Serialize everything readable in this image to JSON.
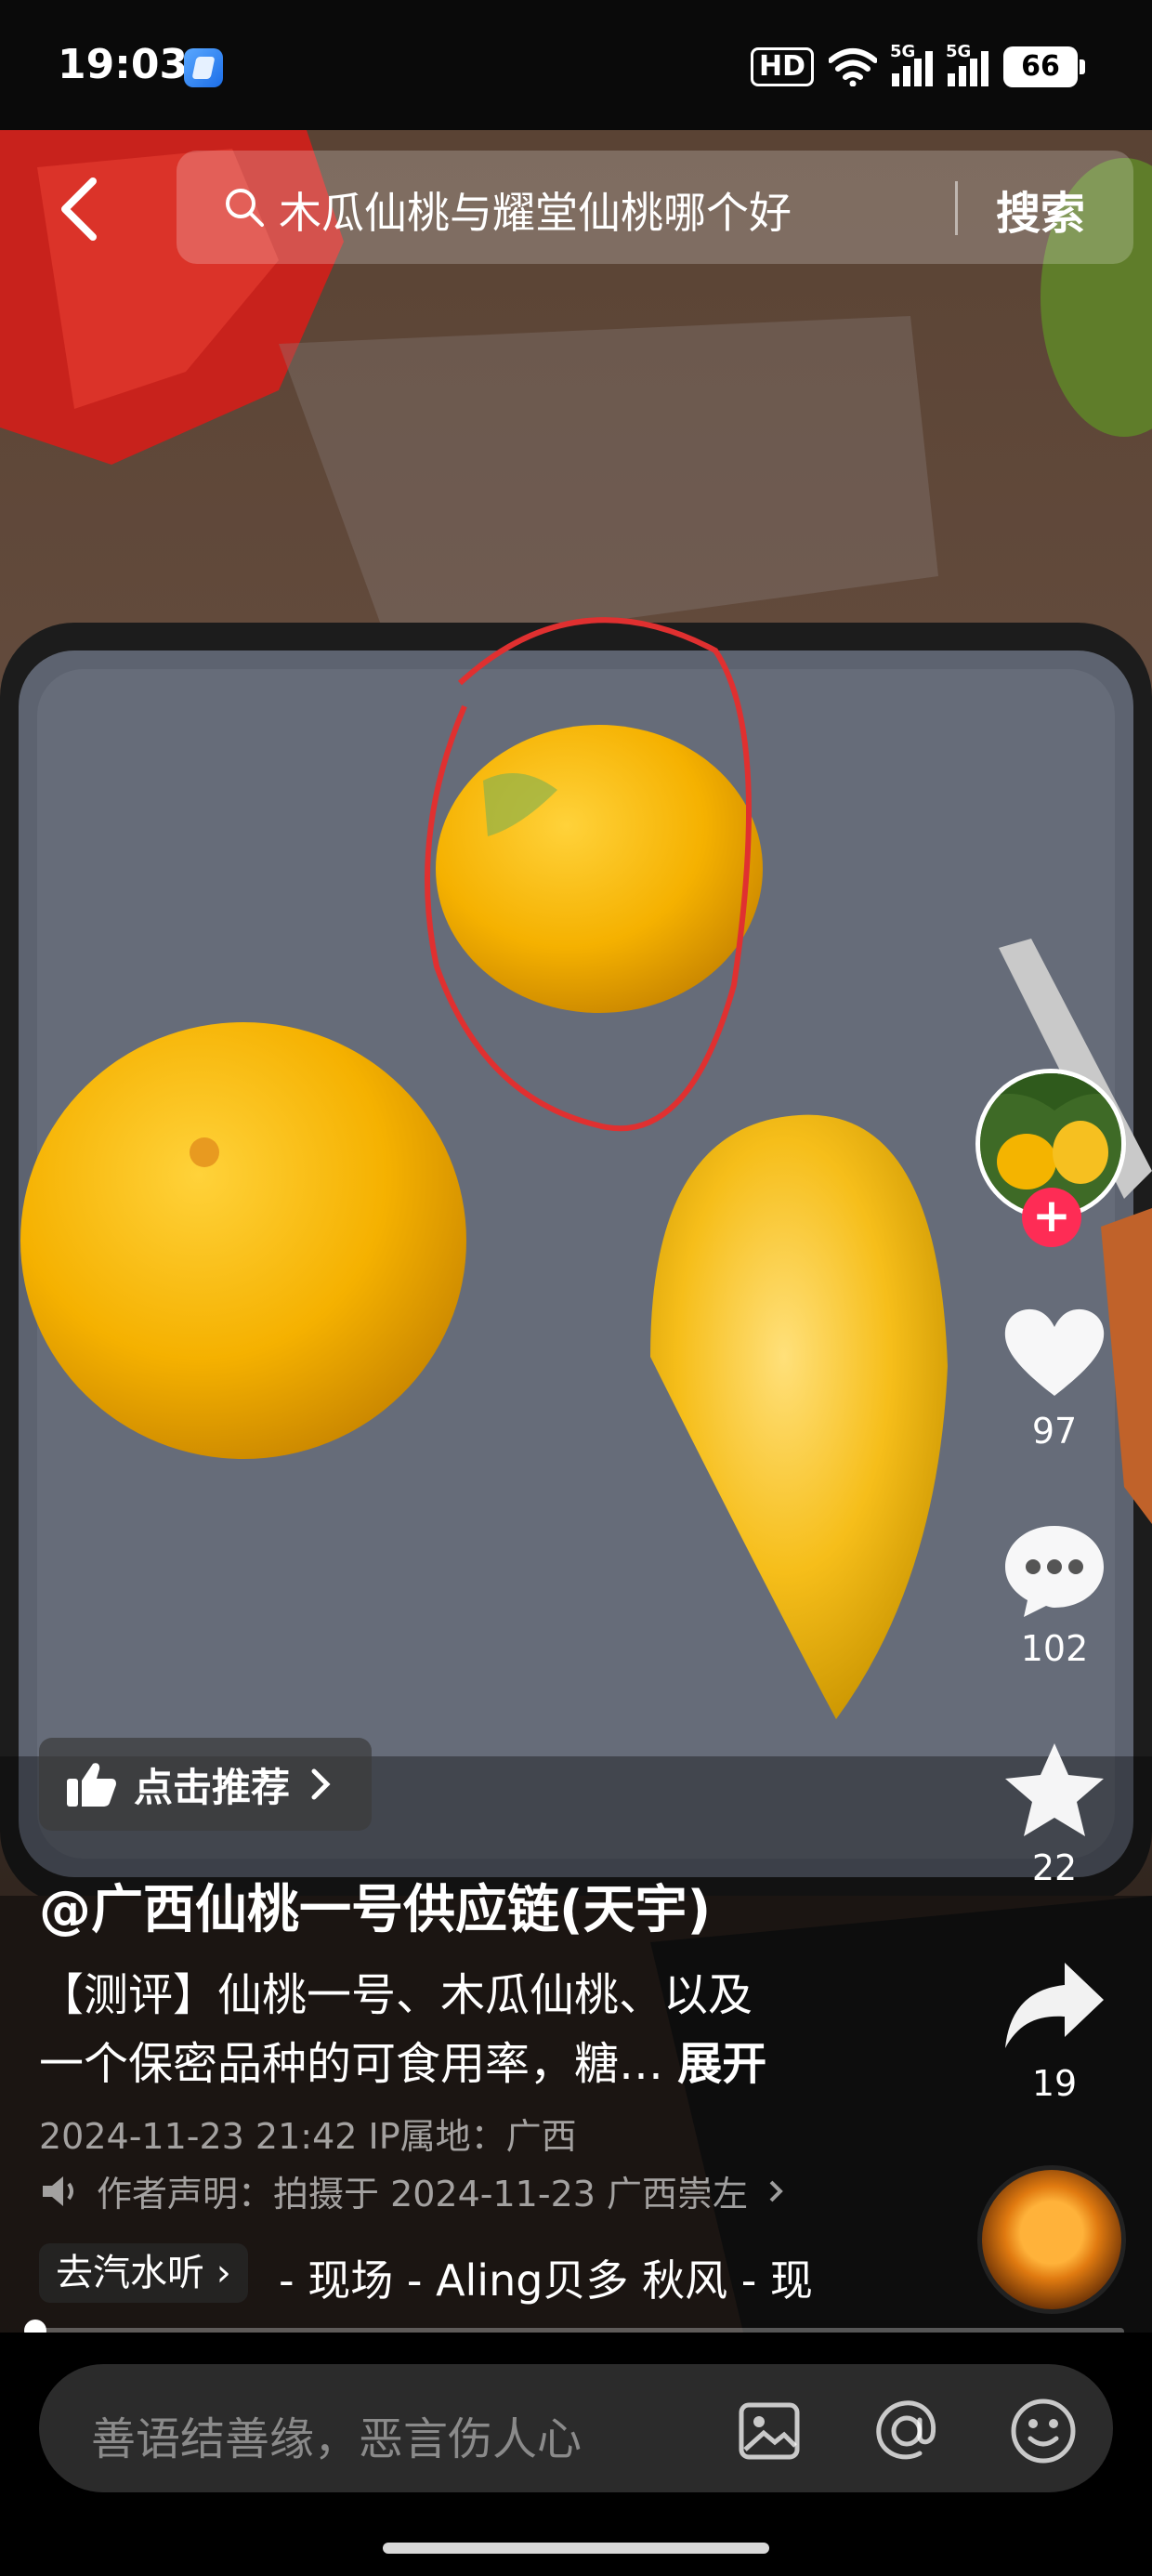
{
  "status_bar": {
    "time": "19:03",
    "hd_label": "HD",
    "network_1": "5G",
    "network_2": "5G",
    "battery": "66"
  },
  "search": {
    "query": "木瓜仙桃与耀堂仙桃哪个好",
    "button_label": "搜索"
  },
  "actions": {
    "likes": "97",
    "comments": "102",
    "favorites": "22",
    "shares": "19"
  },
  "post": {
    "recommend_label": "点击推荐",
    "author": "@广西仙桃一号供应链(天宇)",
    "description_line1": "【测评】仙桃一号、木瓜仙桃、以及",
    "description_line2": "一个保密品种的可食用率，糖…",
    "expand_label": "展开",
    "meta": "2024-11-23 21:42  IP属地：广西",
    "statement": "作者声明：拍摄于 2024-11-23 广西崇左",
    "listen_label": "去汽水听",
    "music": "- 现场 - Aling贝多   秋风 - 现"
  },
  "playback": {
    "progress": 0.01
  },
  "comment": {
    "placeholder": "善语结善缘，恶言伤人心"
  },
  "colors": {
    "accent": "#fe2c55",
    "fruit": "#f4b400"
  }
}
